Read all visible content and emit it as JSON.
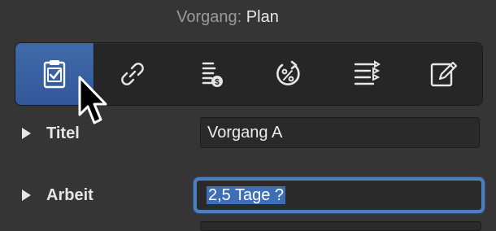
{
  "header": {
    "prefix": "Vorgang:",
    "name": "Plan"
  },
  "toolbar": {
    "items": [
      {
        "icon": "clipboard-check-icon",
        "active": true
      },
      {
        "icon": "link-icon",
        "active": false
      },
      {
        "icon": "cost-list-icon",
        "active": false
      },
      {
        "icon": "percent-cycle-icon",
        "active": false
      },
      {
        "icon": "list-arrows-icon",
        "active": false
      },
      {
        "icon": "edit-note-icon",
        "active": false
      }
    ]
  },
  "fields": {
    "titel": {
      "label": "Titel",
      "value": "Vorgang A"
    },
    "arbeit": {
      "label": "Arbeit",
      "value": "2,5 Tage ?"
    }
  },
  "colors": {
    "accent": "#3f6aa8",
    "focus_ring": "#4d7fbf",
    "background": "#353535"
  }
}
